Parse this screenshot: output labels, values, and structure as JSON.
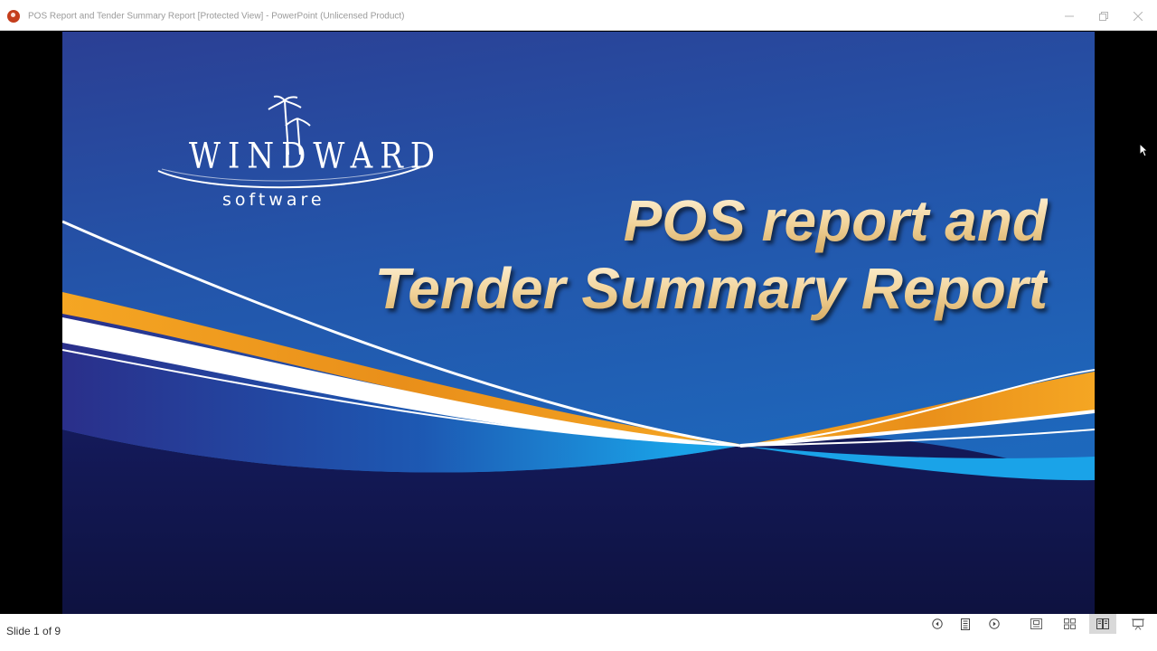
{
  "window": {
    "title": "POS Report and Tender Summary Report [Protected View] - PowerPoint (Unlicensed Product)",
    "app_icon": "powerpoint-icon",
    "controls": [
      "minimize-icon",
      "restore-icon",
      "close-icon"
    ]
  },
  "slide": {
    "logo": {
      "wordmark": "WINDWARD",
      "subtitle": "software",
      "icon": "palm-tree-icon"
    },
    "title_line1": "POS report and",
    "title_line2": "Tender Summary Report",
    "colors": {
      "background_top": "#2b3f94",
      "background_mid": "#1c67b8",
      "background_bottom": "#101447",
      "accent_orange": "#f5a623",
      "accent_cyan": "#1aa3e8",
      "title_gold": "#f1d39a"
    }
  },
  "statusbar": {
    "slide_counter": "Slide 1 of 9",
    "buttons": [
      "previous-slide-icon",
      "slide-menu-icon",
      "next-slide-icon",
      "normal-view-icon",
      "slide-sorter-icon",
      "reading-view-icon",
      "slideshow-icon"
    ],
    "active_view": "reading-view"
  }
}
